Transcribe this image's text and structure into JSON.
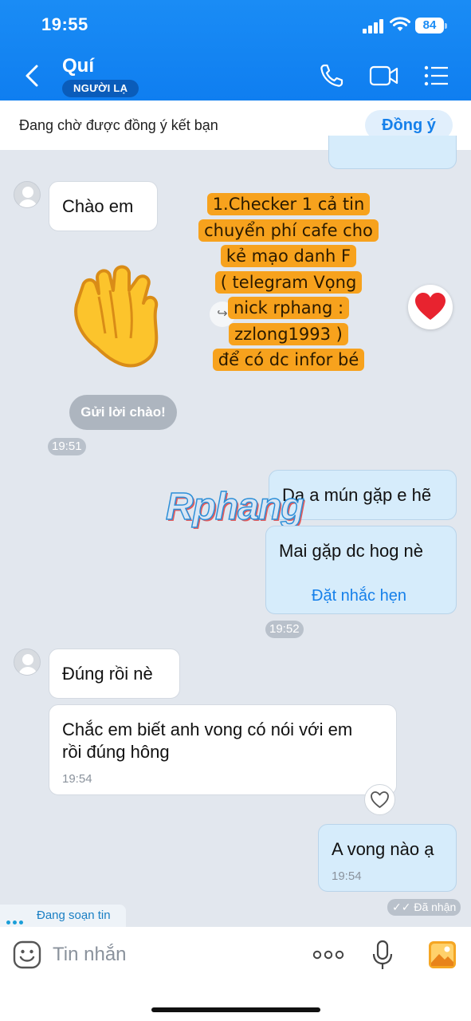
{
  "status_bar": {
    "time": "19:55",
    "battery": "84"
  },
  "header": {
    "contact_name": "Quí",
    "badge": "NGƯỜI LẠ",
    "icons": [
      "back-arrow-icon",
      "phone-icon",
      "video-call-icon",
      "menu-list-icon"
    ]
  },
  "friend_request": {
    "text": "Đang chờ được đồng ý kết bạn",
    "accept_label": "Đồng ý"
  },
  "overlay_note": {
    "lines": [
      "1.Checker 1 cả tin",
      "chuyển phí cafe cho",
      "kẻ mạo danh F",
      "( telegram Vọng",
      "nick rphang :",
      "zzlong1993 )",
      "để có dc infor bé"
    ],
    "color": "#f7a21d"
  },
  "watermark": "Rphang",
  "messages": {
    "m1": {
      "text": "Chào em"
    },
    "greet_button": "Gửi lời chào!",
    "t1": "19:51",
    "m2": {
      "text": "Dạ a mún gặp e hẽ"
    },
    "m3": {
      "text": "Mai gặp dc hog nè",
      "action": "Đặt nhắc hẹn"
    },
    "t2": "19:52",
    "m4": {
      "text": "Đúng rồi nè"
    },
    "m5": {
      "line1": "Chắc em biết anh vong có nói với em",
      "line2": "rồi đúng hông",
      "time": "19:54"
    },
    "m6": {
      "text": "A vong nào ạ",
      "time": "19:54"
    },
    "received": "Đã nhận"
  },
  "typing_indicator": "Đang soạn tin",
  "composer": {
    "placeholder": "Tin nhắn",
    "icons": [
      "emoji-icon",
      "more-icon",
      "microphone-icon",
      "image-icon"
    ]
  },
  "colors": {
    "header": "#1a8cf5",
    "outgoing_bubble": "#d6ecfb",
    "accent": "#1680ea"
  }
}
